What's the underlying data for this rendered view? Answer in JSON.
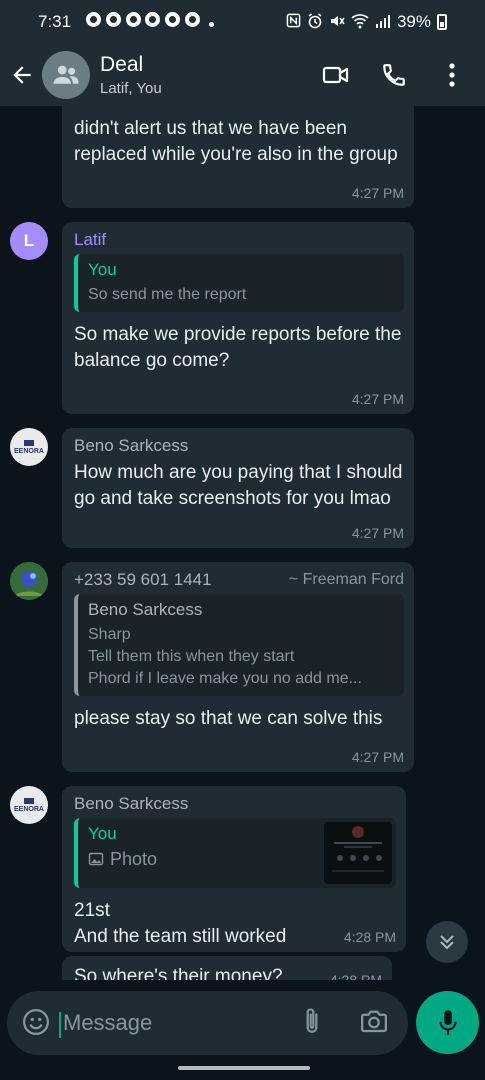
{
  "status_bar": {
    "time": "7:31",
    "battery": "39%"
  },
  "header": {
    "title": "Deal",
    "subtitle": "Latif, You"
  },
  "messages": [
    {
      "body": "didn't alert us that we have been replaced while you're also in the group",
      "time": "4:27 PM"
    },
    {
      "sender": "Latif",
      "sender_color": "#a58cfd",
      "avatar_letter": "L",
      "quote": {
        "author": "You",
        "text": "So send me the report"
      },
      "body": "So make we provide reports before the balance go come?",
      "time": "4:27 PM"
    },
    {
      "sender": "Beno Sarkcess",
      "sender_color": "#aab4ba",
      "avatar_text": "EENORA",
      "body": "How much are you paying that I should go and take screenshots for you lmao",
      "time": "4:27 PM"
    },
    {
      "sender": "+233 59 601 1441",
      "sender_alt": "~ Freeman Ford",
      "sender_color": "#aab4ba",
      "quote": {
        "author": "Beno Sarkcess",
        "lines": [
          "Sharp",
          "Tell them this when they start",
          "Phord if I leave make you no add me..."
        ]
      },
      "body": "please stay so that we can solve this",
      "time": "4:27 PM"
    },
    {
      "sender": "Beno Sarkcess",
      "sender_color": "#aab4ba",
      "avatar_text": "EENORA",
      "quote": {
        "author": "You",
        "text": "Photo"
      },
      "body_lines": [
        "21st",
        "And the team still worked"
      ],
      "time": "4:28 PM"
    },
    {
      "body": "So where's their money?",
      "time": "4:28 PM"
    }
  ],
  "input": {
    "placeholder": "Message"
  },
  "colors": {
    "accent": "#00a884",
    "bubble": "#202c33",
    "background": "#0b141a",
    "header": "#1f2c34"
  },
  "icons": [
    "back-arrow-icon",
    "group-icon",
    "video-call-icon",
    "phone-icon",
    "more-vert-icon",
    "emoji-icon",
    "attach-icon",
    "camera-icon",
    "mic-icon",
    "chevron-double-down-icon"
  ]
}
